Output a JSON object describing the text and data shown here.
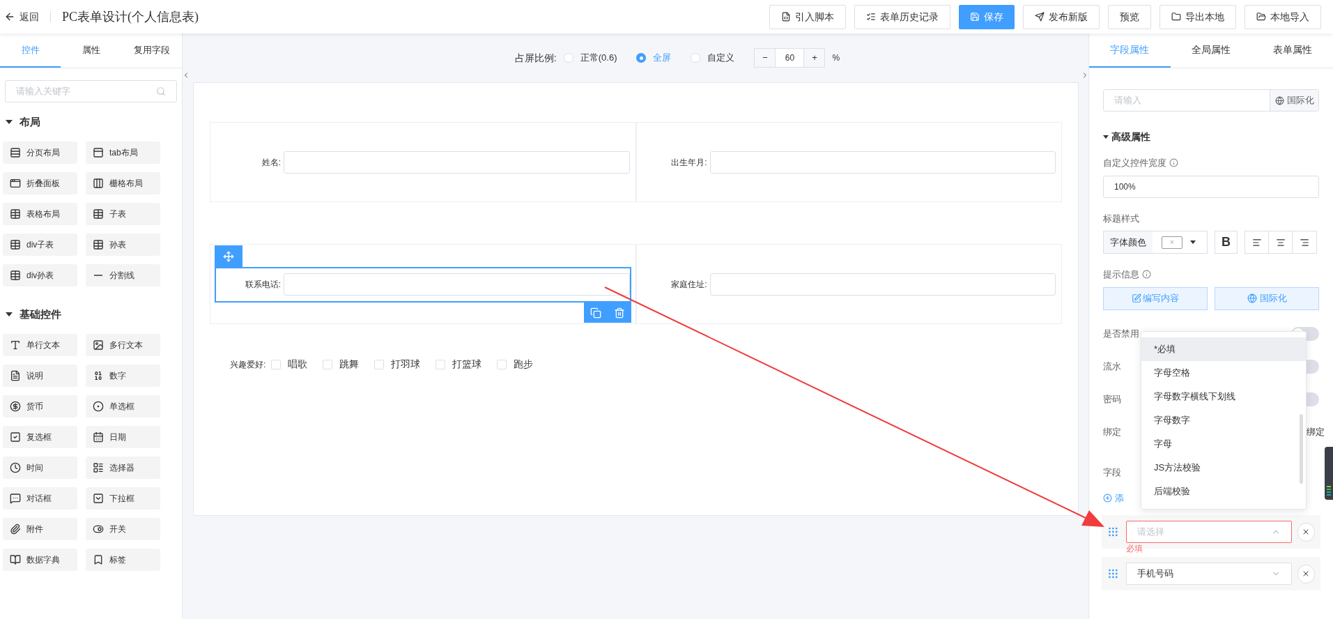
{
  "header": {
    "back": "返回",
    "title": "PC表单设计(个人信息表)",
    "buttons": [
      {
        "label": "引入脚本",
        "primary": false
      },
      {
        "label": "表单历史记录",
        "primary": false
      },
      {
        "label": "保存",
        "primary": true
      },
      {
        "label": "发布新版",
        "primary": false
      },
      {
        "label": "预览",
        "primary": false
      },
      {
        "label": "导出本地",
        "primary": false
      },
      {
        "label": "本地导入",
        "primary": false
      }
    ]
  },
  "left_panel": {
    "tabs": [
      {
        "label": "控件",
        "selected": true
      },
      {
        "label": "属性",
        "selected": false
      },
      {
        "label": "复用字段",
        "selected": false
      }
    ],
    "search": {
      "placeholder": "请输入关键字"
    },
    "groups": [
      {
        "title": "布局",
        "expanded": true,
        "items": [
          "分页布局",
          "tab布局",
          "折叠面板",
          "栅格布局",
          "表格布局",
          "子表",
          "div子表",
          "孙表",
          "div孙表",
          "分割线"
        ]
      },
      {
        "title": "基础控件",
        "expanded": true,
        "items": [
          "单行文本",
          "多行文本",
          "说明",
          "数字",
          "货币",
          "单选框",
          "复选框",
          "日期",
          "时间",
          "选择器",
          "对话框",
          "下拉框",
          "附件",
          "开关",
          "数据字典",
          "标签"
        ]
      }
    ]
  },
  "canvas": {
    "ratio": {
      "label": "占屏比例:",
      "options": [
        {
          "label": "正常(0.6)",
          "selected": false
        },
        {
          "label": "全屏",
          "selected": true
        },
        {
          "label": "自定义",
          "selected": false
        }
      ],
      "minus": "−",
      "zoom": "60",
      "plus": "+",
      "unit": "%"
    },
    "rows": [
      [
        {
          "label": "姓名:",
          "selected": false
        },
        {
          "label": "出生年月:",
          "selected": false
        }
      ],
      [
        {
          "label": "联系电话:",
          "selected": true
        },
        {
          "label": "家庭住址:",
          "selected": false
        }
      ]
    ],
    "hobbies": {
      "label": "兴趣爱好:",
      "options": [
        {
          "label": "唱歌",
          "checked": false
        },
        {
          "label": "跳舞",
          "checked": false
        },
        {
          "label": "打羽球",
          "checked": false
        },
        {
          "label": "打篮球",
          "checked": false
        },
        {
          "label": "跑步",
          "checked": false
        }
      ]
    }
  },
  "right_panel": {
    "tabs": [
      {
        "label": "字段属性",
        "selected": true
      },
      {
        "label": "全局属性",
        "selected": false
      },
      {
        "label": "表单属性",
        "selected": false
      }
    ],
    "name_input": {
      "placeholder": "请输入",
      "i18n": "国际化"
    },
    "advanced": {
      "title": "高级属性",
      "expanded": true
    },
    "width": {
      "label": "自定义控件宽度",
      "value": "100%"
    },
    "title_style": {
      "label": "标题样式",
      "font_color": "字体颜色",
      "clear": "×",
      "bold": "B"
    },
    "hint": {
      "label": "提示信息",
      "edit": "编写内容",
      "i18n": "国际化"
    },
    "switches": [
      {
        "label": "是否禁用",
        "on": false
      },
      {
        "label": "流水",
        "on": false
      },
      {
        "label": "密码",
        "on": false
      }
    ],
    "bind": {
      "label": "绑定",
      "action": "绑定"
    },
    "validation": {
      "label": "字段",
      "add": "添",
      "rules": [
        {
          "placeholder": "请选择",
          "invalid": true,
          "error": "必填",
          "open": true
        },
        {
          "value": "手机号码",
          "invalid": false,
          "open": false
        }
      ]
    },
    "dropdown": {
      "options": [
        {
          "label": "*必填",
          "highlighted": true
        },
        {
          "label": "字母空格",
          "highlighted": false
        },
        {
          "label": "字母数字横线下划线",
          "highlighted": false
        },
        {
          "label": "字母数字",
          "highlighted": false
        },
        {
          "label": "字母",
          "highlighted": false
        },
        {
          "label": "JS方法校验",
          "highlighted": false
        },
        {
          "label": "后端校验",
          "highlighted": false
        }
      ]
    }
  }
}
